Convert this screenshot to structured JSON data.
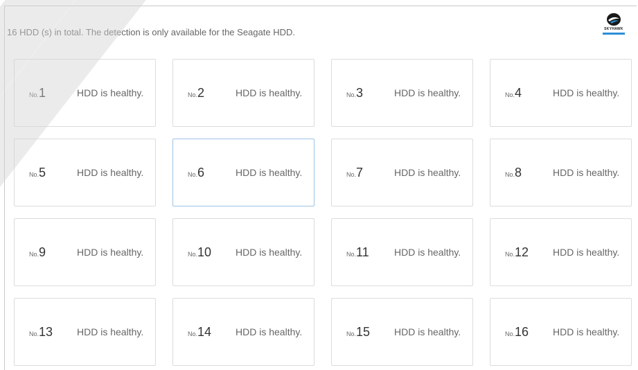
{
  "summary": "16 HDD (s) in total. The detection is only available for the Seagate HDD.",
  "logo": {
    "text": "SKYHAWK",
    "accent": "#2a8ed8"
  },
  "disks": [
    {
      "prefix": "No.",
      "index": "1",
      "status": "HDD is healthy."
    },
    {
      "prefix": "No.",
      "index": "2",
      "status": "HDD is healthy."
    },
    {
      "prefix": "No.",
      "index": "3",
      "status": "HDD is healthy."
    },
    {
      "prefix": "No.",
      "index": "4",
      "status": "HDD is healthy."
    },
    {
      "prefix": "No.",
      "index": "5",
      "status": "HDD is healthy."
    },
    {
      "prefix": "No.",
      "index": "6",
      "status": "HDD is healthy."
    },
    {
      "prefix": "No.",
      "index": "7",
      "status": "HDD is healthy."
    },
    {
      "prefix": "No.",
      "index": "8",
      "status": "HDD is healthy."
    },
    {
      "prefix": "No.",
      "index": "9",
      "status": "HDD is healthy."
    },
    {
      "prefix": "No.",
      "index": "10",
      "status": "HDD is healthy."
    },
    {
      "prefix": "No.",
      "index": "11",
      "status": "HDD is healthy."
    },
    {
      "prefix": "No.",
      "index": "12",
      "status": "HDD is healthy."
    },
    {
      "prefix": "No.",
      "index": "13",
      "status": "HDD is healthy."
    },
    {
      "prefix": "No.",
      "index": "14",
      "status": "HDD is healthy."
    },
    {
      "prefix": "No.",
      "index": "15",
      "status": "HDD is healthy."
    },
    {
      "prefix": "No.",
      "index": "16",
      "status": "HDD is healthy."
    }
  ],
  "selected_index": "6"
}
